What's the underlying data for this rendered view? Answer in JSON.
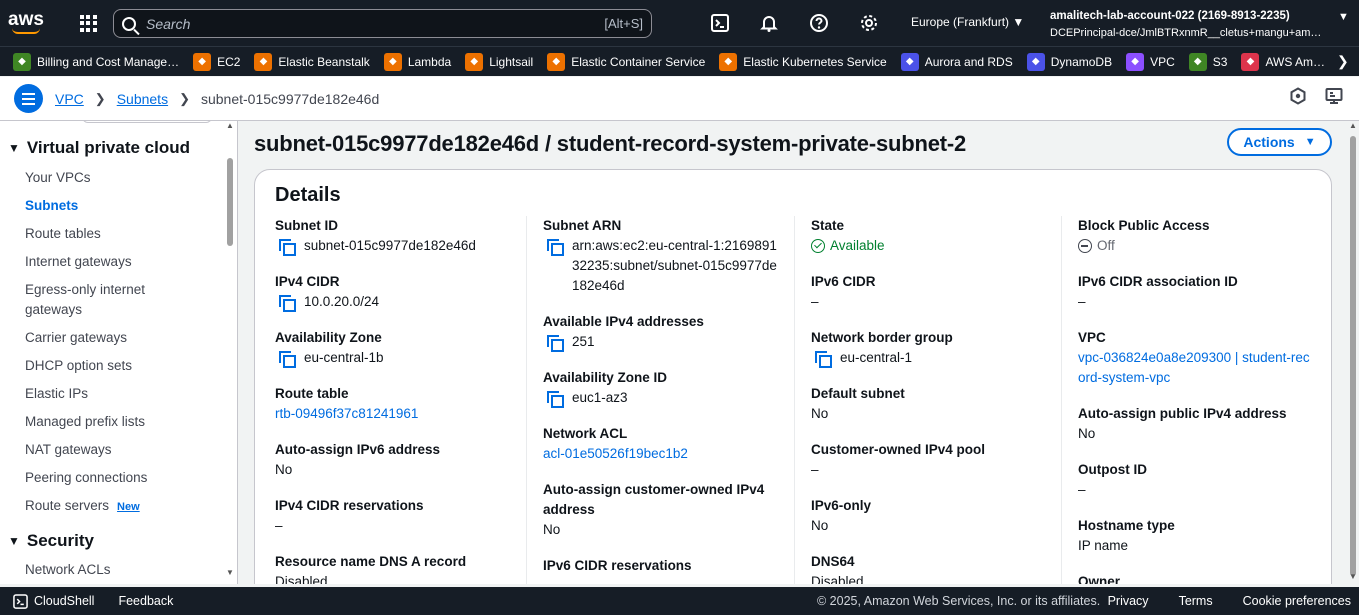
{
  "topbar": {
    "logo": "aws",
    "search_placeholder": "Search",
    "search_shortcut": "[Alt+S]",
    "region": "Europe (Frankfurt)",
    "account_name": "amalitech-lab-account-022 (2169-8913-2235)",
    "account_role": "DCEPrincipal-dce/JmlBTRxnmR__cletus+mangu+am…"
  },
  "favorites": [
    {
      "label": "Billing and Cost Manage…",
      "color": "#3f8624",
      "icon": "billing-icon"
    },
    {
      "label": "EC2",
      "color": "#ed7100",
      "icon": "ec2-icon"
    },
    {
      "label": "Elastic Beanstalk",
      "color": "#ed7100",
      "icon": "beanstalk-icon"
    },
    {
      "label": "Lambda",
      "color": "#ed7100",
      "icon": "lambda-icon"
    },
    {
      "label": "Lightsail",
      "color": "#ed7100",
      "icon": "lightsail-icon"
    },
    {
      "label": "Elastic Container Service",
      "color": "#ed7100",
      "icon": "ecs-icon"
    },
    {
      "label": "Elastic Kubernetes Service",
      "color": "#ed7100",
      "icon": "eks-icon"
    },
    {
      "label": "Aurora and RDS",
      "color": "#4b52e8",
      "icon": "rds-icon"
    },
    {
      "label": "DynamoDB",
      "color": "#4b52e8",
      "icon": "dynamodb-icon"
    },
    {
      "label": "VPC",
      "color": "#8c4fff",
      "icon": "vpc-icon"
    },
    {
      "label": "S3",
      "color": "#3f8624",
      "icon": "s3-icon"
    },
    {
      "label": "AWS Am…",
      "color": "#dd344c",
      "icon": "amplify-icon"
    }
  ],
  "breadcrumb": {
    "items": [
      "VPC",
      "Subnets"
    ],
    "current": "subnet-015c9977de182e46d"
  },
  "sidebar": {
    "section1": "Virtual private cloud",
    "items": [
      "Your VPCs",
      "Subnets",
      "Route tables",
      "Internet gateways",
      "Egress-only internet gateways",
      "Carrier gateways",
      "DHCP option sets",
      "Elastic IPs",
      "Managed prefix lists",
      "NAT gateways",
      "Peering connections",
      "Route servers"
    ],
    "new_badge": "New",
    "section2": "Security",
    "items2": [
      "Network ACLs"
    ]
  },
  "page": {
    "title": "subnet-015c9977de182e46d / student-record-system-private-subnet-2",
    "actions": "Actions",
    "details_title": "Details"
  },
  "details": {
    "col1": [
      {
        "label": "Subnet ID",
        "value": "subnet-015c9977de182e46d",
        "copy": true
      },
      {
        "label": "IPv4 CIDR",
        "value": "10.0.20.0/24",
        "copy": true
      },
      {
        "label": "Availability Zone",
        "value": "eu-central-1b",
        "copy": true
      },
      {
        "label": "Route table",
        "value": "rtb-09496f37c81241961",
        "link": true
      },
      {
        "label": "Auto-assign IPv6 address",
        "value": "No"
      },
      {
        "label": "IPv4 CIDR reservations",
        "value": "–"
      },
      {
        "label": "Resource name DNS A record",
        "value": "Disabled"
      }
    ],
    "col2": [
      {
        "label": "Subnet ARN",
        "value": "arn:aws:ec2:eu-central-1:216989132235:subnet/subnet-015c9977de182e46d",
        "copy": true
      },
      {
        "label": "Available IPv4 addresses",
        "value": "251",
        "copy": true
      },
      {
        "label": "Availability Zone ID",
        "value": "euc1-az3",
        "copy": true
      },
      {
        "label": "Network ACL",
        "value": "acl-01e50526f19bec1b2",
        "link": true
      },
      {
        "label": "Auto-assign customer-owned IPv4 address",
        "value": "No"
      },
      {
        "label": "IPv6 CIDR reservations",
        "value": ""
      }
    ],
    "col3": [
      {
        "label": "State",
        "value": "Available",
        "status": "ok"
      },
      {
        "label": "IPv6 CIDR",
        "value": "–"
      },
      {
        "label": "Network border group",
        "value": "eu-central-1",
        "copy": true
      },
      {
        "label": "Default subnet",
        "value": "No"
      },
      {
        "label": "Customer-owned IPv4 pool",
        "value": "–"
      },
      {
        "label": "IPv6-only",
        "value": "No"
      },
      {
        "label": "DNS64",
        "value": "Disabled"
      }
    ],
    "col4": [
      {
        "label": "Block Public Access",
        "value": "Off",
        "status": "off"
      },
      {
        "label": "IPv6 CIDR association ID",
        "value": "–"
      },
      {
        "label": "VPC",
        "value": "vpc-036824e0a8e209300 | student-record-system-vpc",
        "link": true
      },
      {
        "label": "Auto-assign public IPv4 address",
        "value": "No"
      },
      {
        "label": "Outpost ID",
        "value": "–"
      },
      {
        "label": "Hostname type",
        "value": "IP name"
      },
      {
        "label": "Owner",
        "value": ""
      }
    ]
  },
  "footer": {
    "cloudshell": "CloudShell",
    "feedback": "Feedback",
    "copyright": "© 2025, Amazon Web Services, Inc. or its affiliates.",
    "links": [
      "Privacy",
      "Terms",
      "Cookie preferences"
    ]
  }
}
